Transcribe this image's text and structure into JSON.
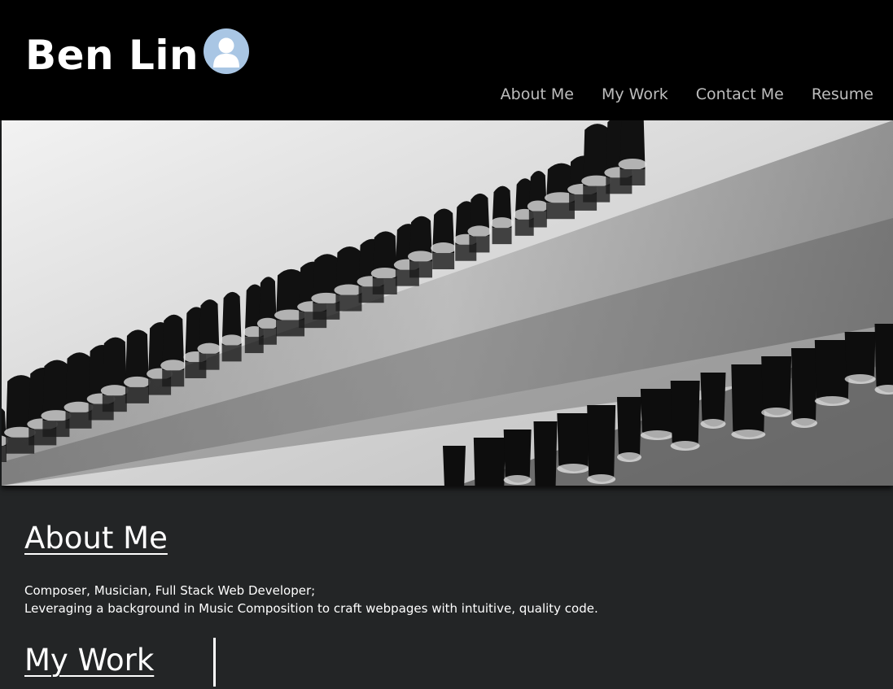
{
  "header": {
    "title": "Ben Lin",
    "avatar_icon": "user-avatar-icon",
    "nav": [
      {
        "label": "About Me"
      },
      {
        "label": "My Work"
      },
      {
        "label": "Contact Me"
      },
      {
        "label": "Resume"
      }
    ]
  },
  "hero": {
    "image": "black-and-white-wooden-pilings-in-water"
  },
  "about": {
    "heading": "About Me",
    "line1": "Composer, Musician, Full Stack Web Developer;",
    "line2": "Leveraging a background in Music Composition to craft webpages with intuitive, quality code."
  },
  "work": {
    "heading": "My Work"
  },
  "colors": {
    "header_bg": "#000000",
    "page_bg": "#232526",
    "nav_text": "#bdbdbd",
    "avatar_bg": "#a9c6e4"
  }
}
